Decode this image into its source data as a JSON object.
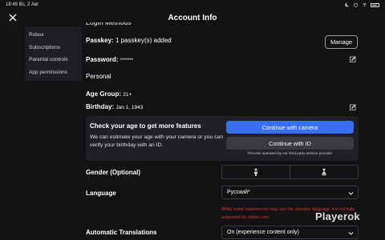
{
  "statusbar": {
    "time": "18:49",
    "date": "Вс, 2 Авг"
  },
  "header": {
    "title": "Account Info"
  },
  "sidebar": {
    "items": [
      {
        "label": "Robux"
      },
      {
        "label": "Subscriptions"
      },
      {
        "label": "Parental controls"
      },
      {
        "label": "App permissions"
      }
    ]
  },
  "account": {
    "login_methods_partial": "Login Methods",
    "passkey_label": "Passkey:",
    "passkey_value": "1 passkey(s) added",
    "manage_label": "Manage",
    "password_label": "Password:",
    "password_value": "*******",
    "personal_heading": "Personal",
    "age_group_label": "Age Group:",
    "age_group_value": "21+",
    "birthday_label": "Birthday:",
    "birthday_value": "Jan 1, 1943"
  },
  "age_check": {
    "title": "Check your age to get more features",
    "body": "We can estimate your age with your camera or you can verify your birthday with an ID.",
    "camera_button": "Continue with camera",
    "id_button": "Continue with ID",
    "note": "Process operated by our third party service provider"
  },
  "gender": {
    "label": "Gender (Optional)"
  },
  "language": {
    "label": "Language",
    "selected": "Русский*",
    "warning": "While some experiences may use the selected language, it is not fully supported by roblox.com."
  },
  "translations": {
    "label": "Automatic Translations",
    "selected": "On (experience content only)"
  },
  "watermark": {
    "text": "Playerok"
  },
  "colors": {
    "background": "#121215",
    "card": "#1f2024",
    "primary_button": "#3a6ff2",
    "secondary_button": "#3a3b40",
    "warning": "#e0382f"
  }
}
